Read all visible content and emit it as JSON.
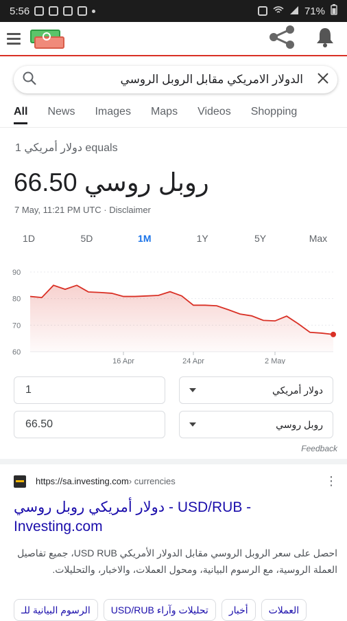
{
  "status_bar": {
    "time": "5:56",
    "battery": "71%"
  },
  "search": {
    "query": "الدولار الامريكي مقابل الروبل الروسي"
  },
  "tabs": [
    "All",
    "News",
    "Images",
    "Maps",
    "Videos",
    "Shopping"
  ],
  "converter": {
    "equals_line": "1 دولار أمريكي equals",
    "result": "66.50 روبل روسي",
    "timestamp": "7 May, 11:21 PM UTC · Disclaimer",
    "ranges": [
      "1D",
      "5D",
      "1M",
      "1Y",
      "5Y",
      "Max"
    ],
    "active_range": "1M",
    "amount_from": "1",
    "currency_from": "دولار أمريكي",
    "amount_to": "66.50",
    "currency_to": "روبل روسي",
    "feedback": "Feedback"
  },
  "chart_data": {
    "type": "area",
    "x": [
      "Apr 8",
      "Apr 9",
      "Apr 10",
      "Apr 11",
      "Apr 12",
      "Apr 13",
      "Apr 14",
      "Apr 15",
      "Apr 16",
      "Apr 18",
      "Apr 19",
      "Apr 20",
      "Apr 21",
      "Apr 22",
      "Apr 24",
      "Apr 25",
      "Apr 26",
      "Apr 27",
      "Apr 28",
      "Apr 29",
      "Apr 30",
      "May 2",
      "May 3",
      "May 4",
      "May 5",
      "May 6",
      "May 7"
    ],
    "values": [
      80.8,
      80.4,
      85.0,
      83.5,
      85.0,
      82.5,
      82.3,
      82.0,
      80.8,
      80.8,
      81.0,
      81.2,
      82.6,
      81.0,
      77.5,
      77.5,
      77.3,
      75.8,
      74.2,
      73.5,
      71.8,
      71.6,
      73.4,
      70.5,
      67.3,
      67.0,
      66.5
    ],
    "ylim": [
      60,
      90
    ],
    "yticks": [
      "90",
      "80",
      "70",
      "60"
    ],
    "xticks": [
      "16 Apr",
      "24 Apr",
      "2 May"
    ],
    "line_color": "#d93025",
    "fill_color": "#fce8e6"
  },
  "result_card": {
    "url": "https://sa.investing.com",
    "path": " › currencies",
    "title": "دولار أمريكي روبل روسي - USD/RUB - Investing.com",
    "snippet": "احصل على سعر الروبل الروسي مقابل الدولار الأمريكي USD RUB، جميع تفاصيل العملة الروسية، مع الرسوم البيانية، ومحول العملات، والاخبار، والتحليلات."
  },
  "chips": [
    "الرسوم البيانية للـ",
    "USD/RUB تحليلات وآراء",
    "أخبار",
    "العملات"
  ]
}
